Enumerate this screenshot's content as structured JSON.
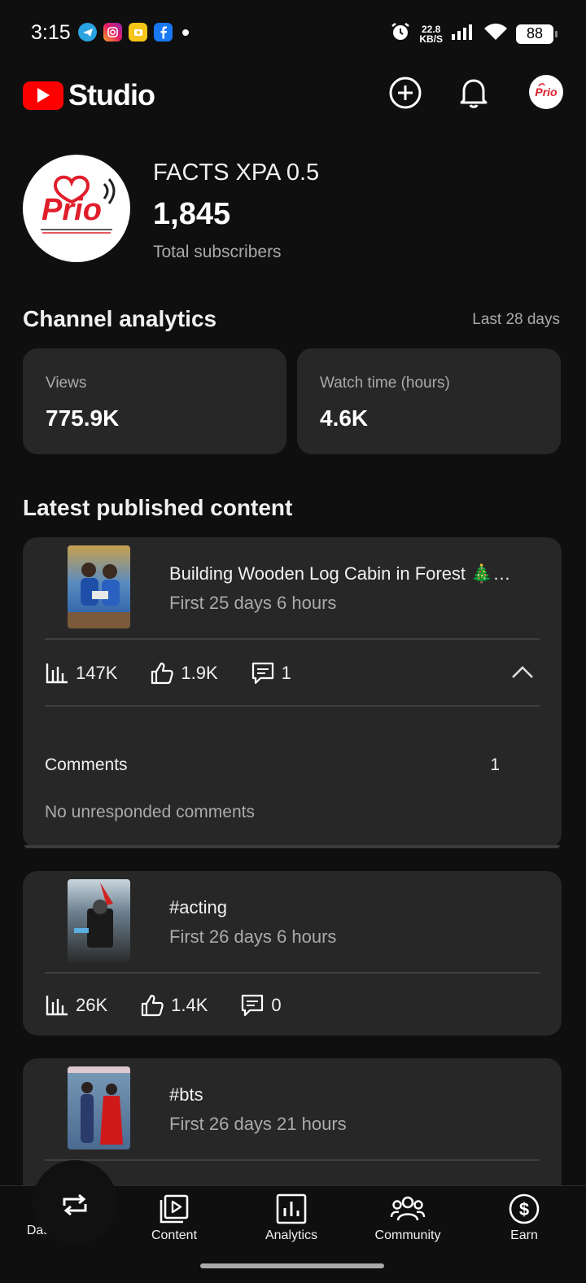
{
  "status_bar": {
    "time": "3:15",
    "speed_value": "22.8",
    "speed_unit": "KB/S",
    "battery": "88"
  },
  "header": {
    "logo_text": "Studio",
    "brand_color": "#ff0000"
  },
  "channel": {
    "name": "FACTS XPA 0.5",
    "subscriber_count": "1,845",
    "subscriber_label": "Total subscribers"
  },
  "analytics": {
    "title": "Channel analytics",
    "range": "Last 28 days",
    "cards": [
      {
        "label": "Views",
        "value": "775.9K"
      },
      {
        "label": "Watch time (hours)",
        "value": "4.6K"
      }
    ]
  },
  "latest": {
    "title": "Latest published content",
    "items": [
      {
        "title": "Building Wooden Log Cabin in Forest 🎄…",
        "subtitle": "First 25 days 6 hours",
        "views": "147K",
        "likes": "1.9K",
        "comments": "1",
        "comments_label": "Comments",
        "comments_count": "1",
        "comments_note": "No unresponded comments"
      },
      {
        "title": "#acting",
        "subtitle": "First 26 days 6 hours",
        "views": "26K",
        "likes": "1.4K",
        "comments": "0"
      },
      {
        "title": "#bts",
        "subtitle": "First 26 days 21 hours"
      }
    ]
  },
  "nav": {
    "items": [
      {
        "label": "Dashboard",
        "icon": "dashboard-icon"
      },
      {
        "label": "Content",
        "icon": "content-icon"
      },
      {
        "label": "Analytics",
        "icon": "analytics-icon"
      },
      {
        "label": "Community",
        "icon": "community-icon"
      },
      {
        "label": "Earn",
        "icon": "earn-icon"
      }
    ]
  }
}
